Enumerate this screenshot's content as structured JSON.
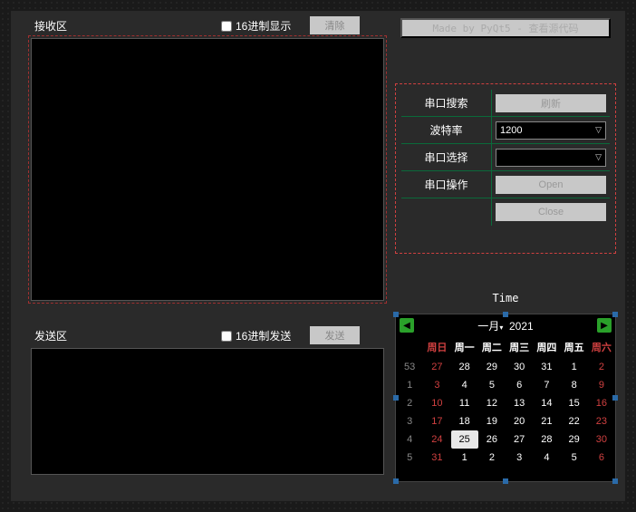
{
  "recv": {
    "label": "接收区",
    "hex_label": "16进制显示",
    "clear_btn": "清除"
  },
  "send": {
    "label": "发送区",
    "hex_label": "16进制发送",
    "send_btn": "发送"
  },
  "madeby": "Made by PyQt5 - 查看源代码",
  "serial": {
    "search_label": "串口搜索",
    "refresh_btn": "刷新",
    "baud_label": "波特率",
    "baud_value": "1200",
    "port_label": "串口选择",
    "port_value": "",
    "op_label": "串口操作",
    "open_btn": "Open",
    "close_btn": "Close"
  },
  "time_label": "Time",
  "calendar": {
    "title_month": "一月",
    "title_year": "2021",
    "dow": [
      "周日",
      "周一",
      "周二",
      "周三",
      "周四",
      "周五",
      "周六"
    ],
    "weeks": [
      {
        "wk": "53",
        "d": [
          "27",
          "28",
          "29",
          "30",
          "31",
          "1",
          "2"
        ],
        "prev": [
          0,
          1,
          2,
          3,
          4
        ]
      },
      {
        "wk": "1",
        "d": [
          "3",
          "4",
          "5",
          "6",
          "7",
          "8",
          "9"
        ]
      },
      {
        "wk": "2",
        "d": [
          "10",
          "11",
          "12",
          "13",
          "14",
          "15",
          "16"
        ]
      },
      {
        "wk": "3",
        "d": [
          "17",
          "18",
          "19",
          "20",
          "21",
          "22",
          "23"
        ]
      },
      {
        "wk": "4",
        "d": [
          "24",
          "25",
          "26",
          "27",
          "28",
          "29",
          "30"
        ],
        "today": 1
      },
      {
        "wk": "5",
        "d": [
          "31",
          "1",
          "2",
          "3",
          "4",
          "5",
          "6"
        ],
        "next": [
          1,
          2,
          3,
          4,
          5,
          6
        ]
      }
    ]
  }
}
